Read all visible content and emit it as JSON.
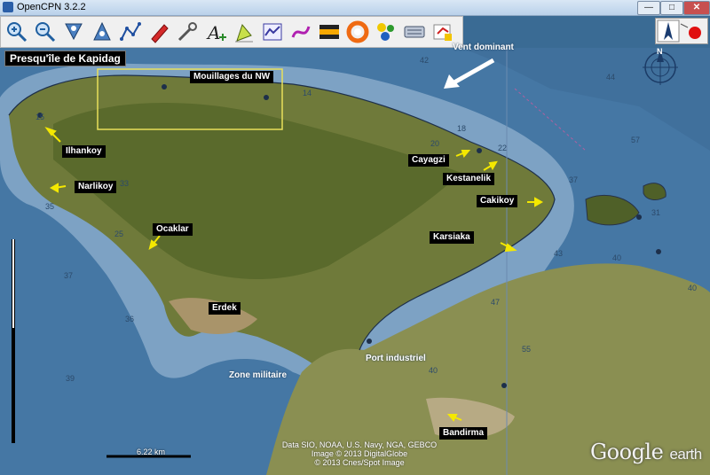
{
  "window": {
    "title": "OpenCPN 3.2.2",
    "min_label": "0",
    "max_label": "1",
    "close_label": "r"
  },
  "toolbar": {
    "tools": [
      {
        "name": "zoom-in-icon"
      },
      {
        "name": "zoom-out-icon"
      },
      {
        "name": "scale-in-icon"
      },
      {
        "name": "scale-out-icon"
      },
      {
        "name": "route-icon"
      },
      {
        "name": "auto-follow-icon"
      },
      {
        "name": "settings-icon"
      },
      {
        "name": "text-icon"
      },
      {
        "name": "current-icon"
      },
      {
        "name": "ais-icon"
      },
      {
        "name": "track-icon"
      },
      {
        "name": "color-scheme-icon"
      },
      {
        "name": "mob-icon"
      },
      {
        "name": "tides-icon"
      },
      {
        "name": "print-icon"
      },
      {
        "name": "route-manager-icon"
      }
    ]
  },
  "map": {
    "title": "Presqu'île de Kapidag",
    "region_label": "Mouillages du NW",
    "wind_label": "Vent dominant",
    "places": {
      "ilhankoy": "Ilhankoy",
      "narlikoy": "Narlikoy",
      "ocaklar": "Ocaklar",
      "erdek": "Erdek",
      "cayagzi": "Cayagzi",
      "kestanelik": "Kestanelik",
      "cakikoy": "Cakikoy",
      "karsiaka": "Karsiaka",
      "bandirma": "Bandirma"
    },
    "free_labels": {
      "zone_militaire": "Zone militaire",
      "port_industriel": "Port industriel"
    },
    "depths": [
      "42",
      "44",
      "57",
      "37",
      "35",
      "33",
      "25",
      "15",
      "37",
      "36",
      "39",
      "43",
      "40",
      "47",
      "55",
      "31",
      "40",
      "40",
      "14",
      "18",
      "20",
      "22"
    ],
    "scale": "6.22 km",
    "credits": [
      "Data SIO, NOAA, U.S. Navy, NGA, GEBCO",
      "Image © 2013 DigitalGlobe",
      "© 2013 Cnes/Spot Image"
    ],
    "watermark": {
      "google": "Google",
      "earth": "earth"
    },
    "compass_north": "N"
  },
  "colors": {
    "label_bg": "#000000",
    "arrow": "#f4e800",
    "region_box": "#e8e05a",
    "sea": "#3d6f9a",
    "shallow": "#7fa0bf"
  }
}
